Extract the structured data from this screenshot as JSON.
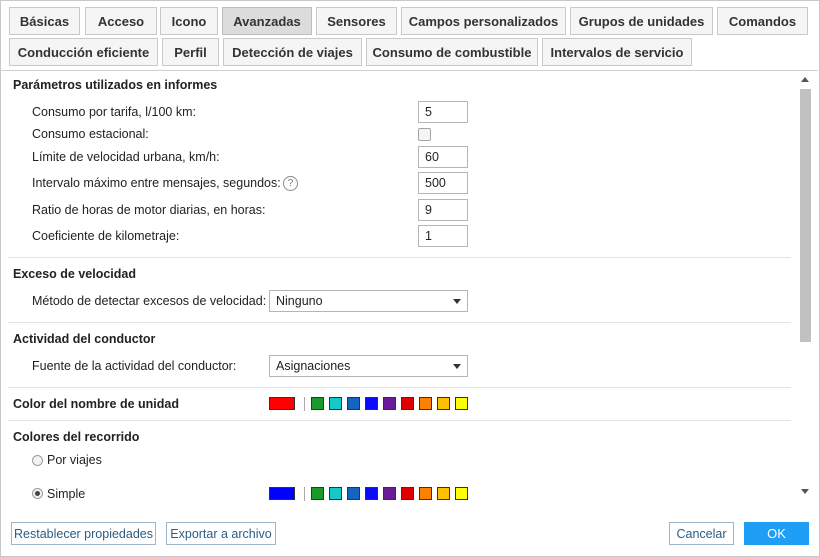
{
  "tabs_row1": [
    "Básicas",
    "Acceso",
    "Icono",
    "Avanzadas",
    "Sensores",
    "Campos personalizados",
    "Grupos de unidades",
    "Comandos"
  ],
  "tabs_row2": [
    "Conducción eficiente",
    "Perfil",
    "Detección de viajes",
    "Consumo de combustible",
    "Intervalos de servicio"
  ],
  "active_tab": "Avanzadas",
  "sections": {
    "params": {
      "title": "Parámetros utilizados en informes",
      "rows": [
        {
          "label": "Consumo por tarifa, l/100 km:",
          "value": "5"
        },
        {
          "label": "Consumo estacional:",
          "checked": false
        },
        {
          "label": "Límite de velocidad urbana, km/h:",
          "value": "60"
        },
        {
          "label": "Intervalo máximo entre mensajes, segundos:",
          "value": "500",
          "help": "?"
        },
        {
          "label": "Ratio de horas de motor diarias, en horas:",
          "value": "9"
        },
        {
          "label": "Coeficiente de kilometraje:",
          "value": "1"
        }
      ]
    },
    "speeding": {
      "title": "Exceso de velocidad",
      "label": "Método de detectar excesos de velocidad:",
      "selected": "Ninguno"
    },
    "driver": {
      "title": "Actividad del conductor",
      "label": "Fuente de la actividad del conductor:",
      "selected": "Asignaciones"
    },
    "unit_color": {
      "title": "Color del nombre de unidad",
      "current": "#ff0000"
    },
    "track_colors": {
      "title": "Colores del recorrido",
      "option_trips": "Por viajes",
      "option_simple": "Simple",
      "selected": "Simple",
      "current": "#0000ff"
    }
  },
  "palette": [
    "#1a9a2a",
    "#17c8c8",
    "#1565c0",
    "#0a0aff",
    "#6a1b9a",
    "#e00000",
    "#ff7f00",
    "#ffbf00",
    "#ffff00"
  ],
  "footer": {
    "reset": "Restablecer propiedades",
    "export": "Exportar a archivo",
    "cancel": "Cancelar",
    "ok": "OK"
  }
}
